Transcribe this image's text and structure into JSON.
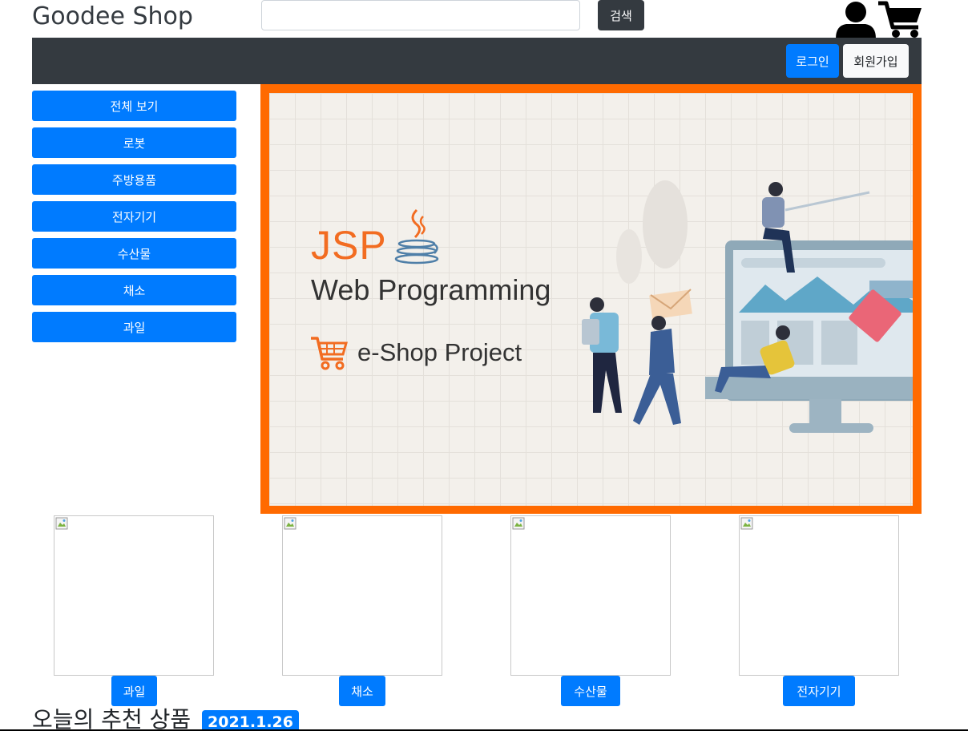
{
  "header": {
    "brand": "Goodee Shop",
    "search": {
      "value": "",
      "placeholder": "",
      "button_label": "검색"
    },
    "icons": [
      "user-icon",
      "cart-icon"
    ]
  },
  "navbar": {
    "login_label": "로그인",
    "signup_label": "회원가입"
  },
  "sidebar": {
    "categories": [
      {
        "label": "전체 보기"
      },
      {
        "label": "로봇"
      },
      {
        "label": "주방용품"
      },
      {
        "label": "전자기기"
      },
      {
        "label": "수산물"
      },
      {
        "label": "채소"
      },
      {
        "label": "과일"
      }
    ]
  },
  "banner": {
    "line1": "JSP",
    "line2": "Web Programming",
    "line3": "e-Shop Project"
  },
  "products": [
    {
      "category": "과일"
    },
    {
      "category": "채소"
    },
    {
      "category": "수산물"
    },
    {
      "category": "전자기기"
    }
  ],
  "recommend": {
    "title": "오늘의 추천 상품",
    "date": "2021.1.26"
  },
  "colors": {
    "primary": "#007bff",
    "dark": "#343a40",
    "banner_border": "#ff6a00",
    "java_orange": "#f26c21"
  }
}
